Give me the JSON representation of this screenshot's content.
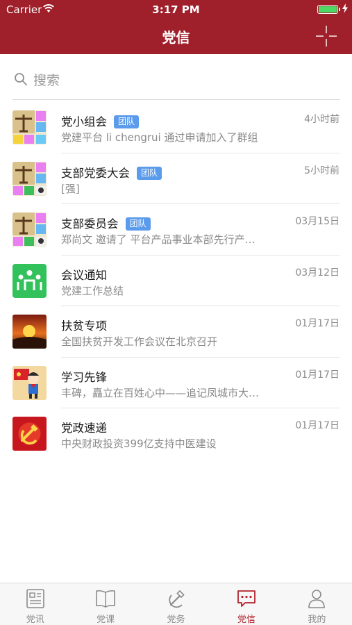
{
  "status_bar": {
    "carrier": "Carrier",
    "time": "3:17 PM",
    "battery_level": 1.0,
    "battery_color": "#4cd964"
  },
  "header": {
    "title": "党信",
    "right_icon": "add-crosshair-icon",
    "background": "#9f1f2a"
  },
  "search": {
    "placeholder": "搜索",
    "icon": "search-icon"
  },
  "conversations": [
    {
      "title": "党小组会",
      "badge": "团队",
      "time": "4小时前",
      "preview": "党建平台 li chengrui  通过申请加入了群组",
      "avatar": "group-collage-icon"
    },
    {
      "title": "支部党委大会",
      "badge": "团队",
      "time": "5小时前",
      "preview": "[强]",
      "avatar": "group-collage-icon"
    },
    {
      "title": "支部委员会",
      "badge": "团队",
      "time": "03月15日",
      "preview": "郑尚文 邀请了  平台产品事业本部先行产…",
      "avatar": "group-collage-icon"
    },
    {
      "title": "会议通知",
      "badge": "",
      "time": "03月12日",
      "preview": "党建工作总结",
      "avatar": "meeting-icon"
    },
    {
      "title": "扶贫专项",
      "badge": "",
      "time": "01月17日",
      "preview": "全国扶贫开发工作会议在北京召开",
      "avatar": "poverty-relief-icon"
    },
    {
      "title": "学习先锋",
      "badge": "",
      "time": "01月17日",
      "preview": "丰碑，矗立在百姓心中——追记凤城市大…",
      "avatar": "study-pioneer-icon"
    },
    {
      "title": "党政速递",
      "badge": "",
      "time": "01月17日",
      "preview": "中央财政投资399亿支持中医建设",
      "avatar": "party-emblem-icon"
    }
  ],
  "tab_bar": {
    "active_color": "#b1222c",
    "tabs": [
      {
        "label": "党讯",
        "icon": "news-icon"
      },
      {
        "label": "党课",
        "icon": "book-icon"
      },
      {
        "label": "党务",
        "icon": "hammer-sickle-icon"
      },
      {
        "label": "党信",
        "icon": "chat-bubble-icon",
        "active": true
      },
      {
        "label": "我的",
        "icon": "person-icon"
      }
    ]
  }
}
